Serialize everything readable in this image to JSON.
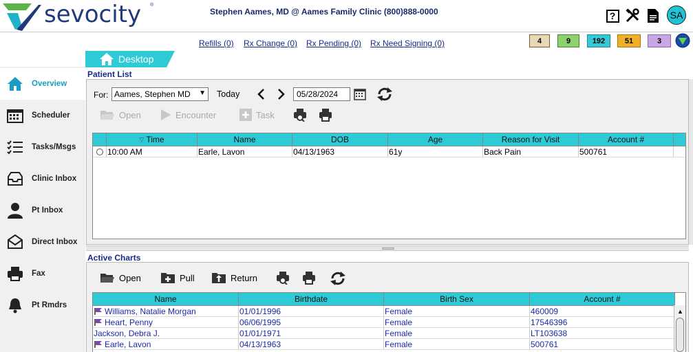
{
  "header": {
    "brand": "sevocity",
    "reg_mark": "®",
    "provider": "Stephen Aames, MD @ Aames Family Clinic (800)888-0000",
    "avatar_initials": "SA",
    "help_glyph": "?"
  },
  "rx_links": [
    "Refills (0)",
    "Rx Change (0)",
    "Rx Pending (0)",
    "Rx Need Signing (0)"
  ],
  "badges": [
    "4",
    "9",
    "192",
    "51",
    "3"
  ],
  "tab": {
    "label": "Desktop"
  },
  "sidebar": {
    "items": [
      {
        "label": "Overview",
        "icon": "home-icon",
        "active": true
      },
      {
        "label": "Scheduler",
        "icon": "calendar-icon"
      },
      {
        "label": "Tasks/Msgs",
        "icon": "checklist-icon"
      },
      {
        "label": "Clinic Inbox",
        "icon": "inbox-icon"
      },
      {
        "label": "Pt Inbox",
        "icon": "person-icon"
      },
      {
        "label": "Direct Inbox",
        "icon": "envelope-icon"
      },
      {
        "label": "Fax",
        "icon": "fax-icon"
      },
      {
        "label": "Pt Rmdrs",
        "icon": "bell-icon"
      }
    ]
  },
  "patient_list": {
    "title": "Patient List",
    "for_label": "For:",
    "for_value": "Aames, Stephen MD",
    "today_label": "Today",
    "date_value": "05/28/2024",
    "toolbar": {
      "open": "Open",
      "encounter": "Encounter",
      "task": "Task"
    },
    "sort_glyph": "▽",
    "columns": [
      "Time",
      "Name",
      "DOB",
      "Age",
      "Reason for Visit",
      "Account #"
    ],
    "rows": [
      {
        "time": "10:00 AM",
        "name": "Earle, Lavon",
        "dob": "04/13/1963",
        "age": "61y",
        "reason": "Back Pain",
        "account": "500761"
      }
    ]
  },
  "active_charts": {
    "title": "Active Charts",
    "toolbar": {
      "open": "Open",
      "pull": "Pull",
      "return": "Return"
    },
    "columns": [
      "Name",
      "Birthdate",
      "Birth Sex",
      "Account #"
    ],
    "rows": [
      {
        "name": "Williams, Natalie Morgan",
        "birthdate": "01/01/1996",
        "sex": "Female",
        "account": "460009",
        "flag": true
      },
      {
        "name": "Heart, Penny",
        "birthdate": "06/06/1995",
        "sex": "Female",
        "account": "17546396",
        "flag": true
      },
      {
        "name": "Jackson, Debra J.",
        "birthdate": "01/01/1971",
        "sex": "Female",
        "account": "LT103638",
        "flag": false
      },
      {
        "name": "Earle, Lavon",
        "birthdate": "04/13/1963",
        "sex": "Female",
        "account": "500761",
        "flag": true
      }
    ]
  },
  "colors": {
    "header_cyan": "#2ecad6",
    "brand_navy": "#233a7a",
    "active_nav": "#1a9dc4",
    "link": "#1a2aa8"
  }
}
